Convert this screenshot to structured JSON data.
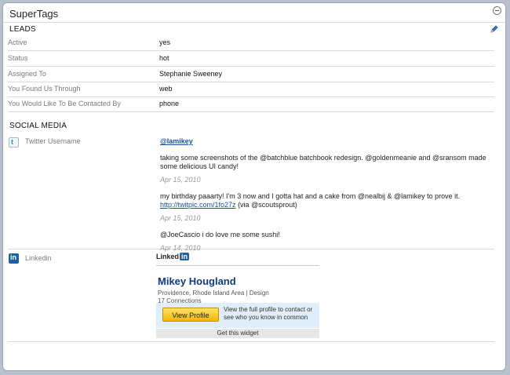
{
  "panel": {
    "title": "SuperTags"
  },
  "leads": {
    "heading": "LEADS",
    "rows": [
      {
        "label": "Active",
        "value": "yes"
      },
      {
        "label": "Status",
        "value": "hot"
      },
      {
        "label": "Assigned To",
        "value": "Stephanie Sweeney"
      },
      {
        "label": "You Found Us Through",
        "value": "web"
      },
      {
        "label": "You Would Like To Be Contacted By",
        "value": "phone"
      }
    ]
  },
  "social": {
    "heading": "SOCIAL MEDIA",
    "twitter": {
      "label": "Twitter Username",
      "handle": "@lamikey",
      "tweets": [
        {
          "text": "taking some screenshots of the @batchblue batchbook redesign. @goldenmeanie and @sransom made some delicious UI candy!",
          "link": "",
          "suffix": "",
          "date": "Apr 15, 2010"
        },
        {
          "text": "my birthday paaarty! I'm 3 now and I gotta hat and a cake from @nealbij & @lamikey to prove it.",
          "link": "http://twitpic.com/1fo27z",
          "suffix": "(via @scoutsprout)",
          "date": "Apr 15, 2010"
        },
        {
          "text": "@JoeCascio i do love me some sushi!",
          "link": "",
          "suffix": "",
          "date": "Apr 14, 2010"
        }
      ]
    },
    "linkedin": {
      "label": "Linkedin",
      "logo_text": "Linked",
      "logo_in": "in",
      "name": "Mikey Hougland",
      "location": "Providence, Rhode Island Area | Design",
      "connections": "17 Connections",
      "button": "View Profile",
      "cta": "View the full profile to contact or see who you know in common",
      "get_widget": "Get this widget"
    }
  },
  "icons": {
    "collapse": "minus-circle-icon",
    "edit": "pencil-icon",
    "twitter": "twitter-icon",
    "linkedin": "linkedin-icon"
  }
}
